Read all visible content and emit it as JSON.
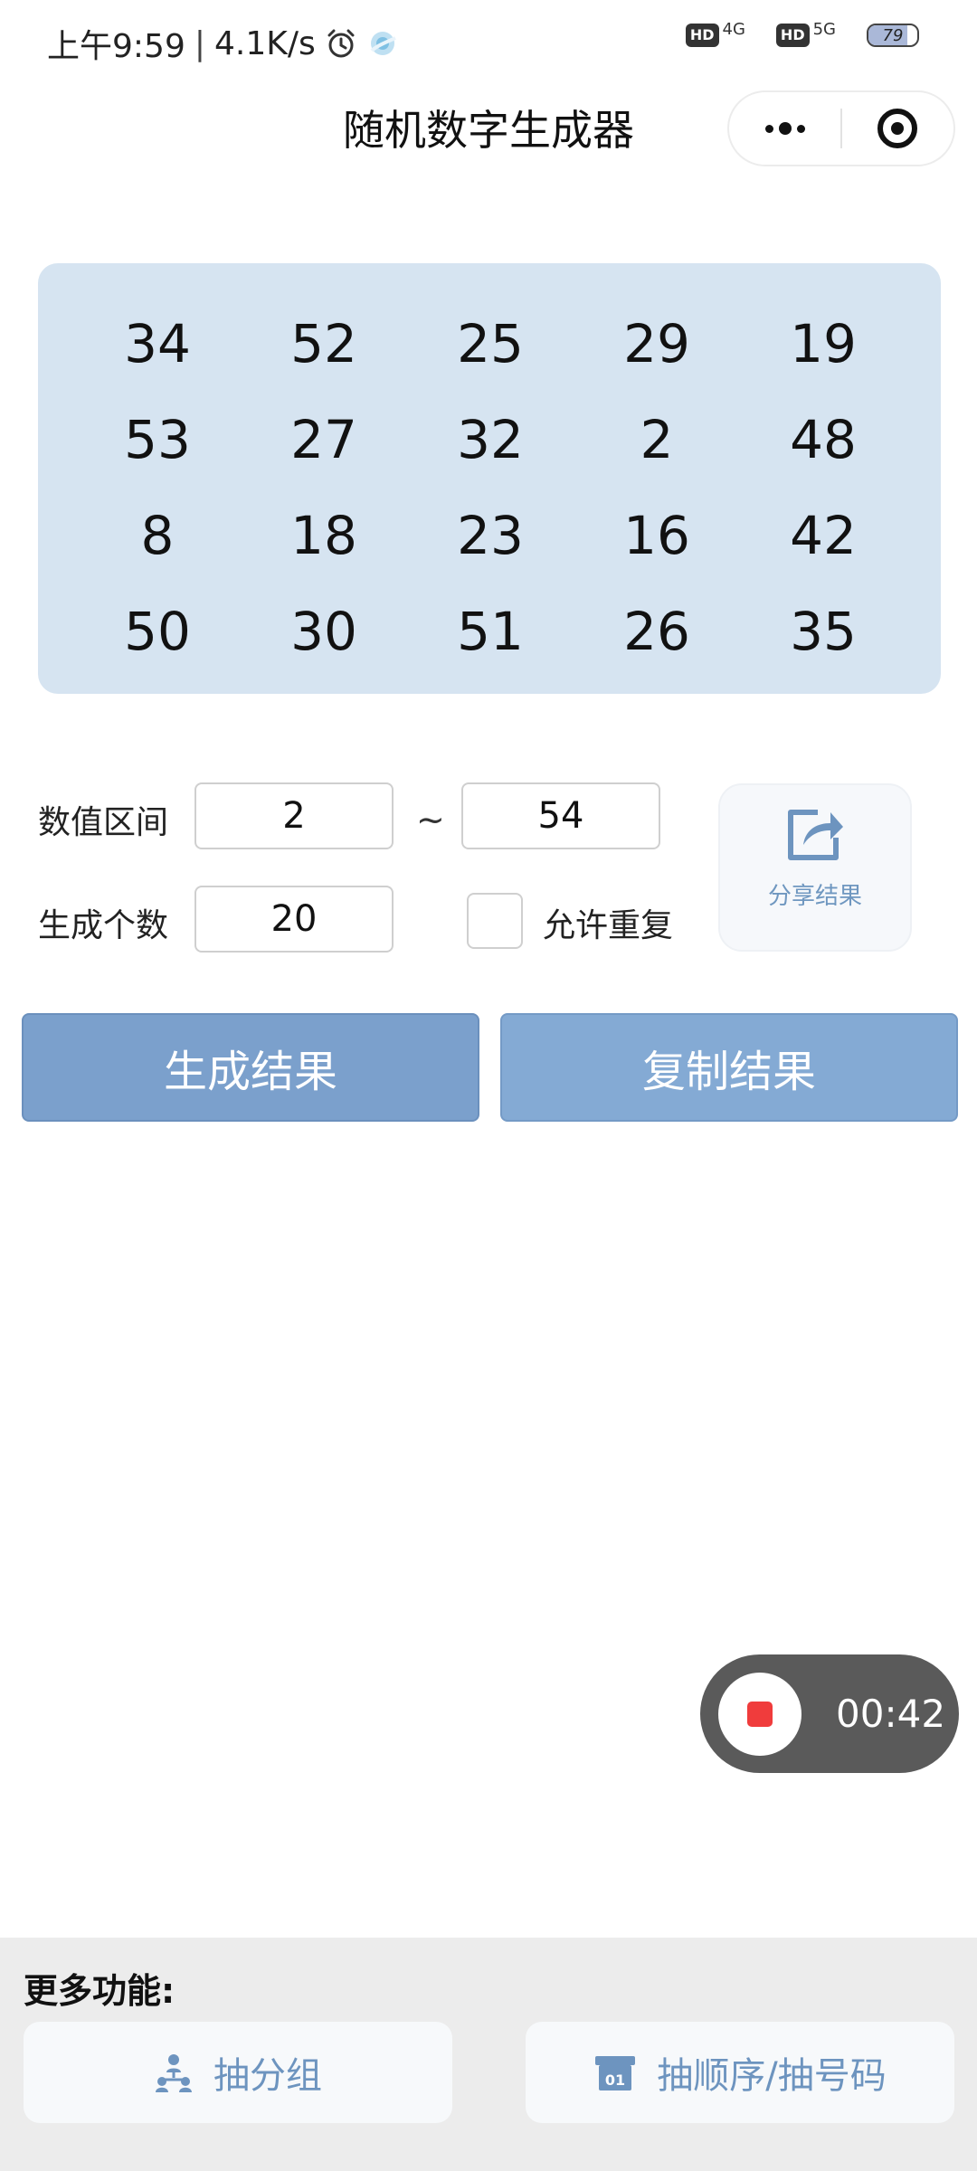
{
  "status_bar": {
    "time": "上午9:59",
    "speed": "4.1K/s",
    "network_1": "4G",
    "network_2": "5G",
    "hd_label": "HD",
    "battery_level": "79",
    "icons": [
      "alarm-icon",
      "app-status-icon",
      "hd-signal-icon",
      "battery-icon"
    ]
  },
  "header": {
    "title": "随机数字生成器",
    "capsule": [
      "more-dots-icon",
      "close-target-icon"
    ]
  },
  "results": {
    "rows": [
      [
        "34",
        "52",
        "25",
        "29",
        "19"
      ],
      [
        "53",
        "27",
        "32",
        "2",
        "48"
      ],
      [
        "8",
        "18",
        "23",
        "16",
        "42"
      ],
      [
        "50",
        "30",
        "51",
        "26",
        "35"
      ]
    ]
  },
  "form": {
    "range_label": "数值区间",
    "range_min": "2",
    "range_separator": "~",
    "range_max": "54",
    "count_label": "生成个数",
    "count_value": "20",
    "allow_repeat_label": "允许重复",
    "allow_repeat_checked": false,
    "share_label": "分享结果"
  },
  "actions": {
    "generate": "生成结果",
    "copy": "复制结果"
  },
  "recording": {
    "time": "00:42"
  },
  "more": {
    "title": "更多功能:",
    "group_label": "抽分组",
    "order_label": "抽顺序/抽号码",
    "order_icon_text": "01"
  },
  "colors": {
    "panel_bg": "#d6e4f1",
    "button_primary": "#7ba0cc",
    "button_secondary": "#84aad4",
    "accent_text": "#6d94bf",
    "record_red": "#f03c3c"
  }
}
